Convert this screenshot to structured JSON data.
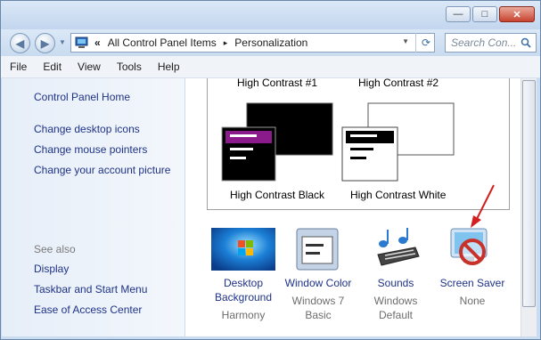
{
  "window": {
    "minimize": "—",
    "maximize": "□",
    "close": "✕"
  },
  "nav": {
    "back": "◀",
    "forward": "▶",
    "breadcrumb": [
      "All Control Panel Items",
      "Personalization"
    ],
    "overflow": "«",
    "separator": "▸",
    "refresh": "⟳",
    "search_placeholder": "Search Con..."
  },
  "menu": [
    "File",
    "Edit",
    "View",
    "Tools",
    "Help"
  ],
  "sidebar": {
    "home": "Control Panel Home",
    "links": [
      "Change desktop icons",
      "Change mouse pointers",
      "Change your account picture"
    ],
    "see_also_label": "See also",
    "see_also": [
      "Display",
      "Taskbar and Start Menu",
      "Ease of Access Center"
    ]
  },
  "themes": {
    "top_labels": [
      "High Contrast #1",
      "High Contrast #2"
    ],
    "bottom_labels": [
      "High Contrast Black",
      "High Contrast White"
    ]
  },
  "bottom": [
    {
      "title": [
        "Desktop",
        "Background"
      ],
      "sub": [
        "Harmony"
      ],
      "icon": "desktop-background-icon"
    },
    {
      "title": [
        "Window Color"
      ],
      "sub": [
        "Windows 7",
        "Basic"
      ],
      "icon": "window-color-icon"
    },
    {
      "title": [
        "Sounds"
      ],
      "sub": [
        "Windows",
        "Default"
      ],
      "icon": "sounds-icon"
    },
    {
      "title": [
        "Screen Saver"
      ],
      "sub": [
        "None"
      ],
      "icon": "screen-saver-icon"
    }
  ],
  "colors": {
    "link": "#1e3287",
    "accent_purple": "#8b1a8b",
    "arrow": "#d31f1f"
  }
}
